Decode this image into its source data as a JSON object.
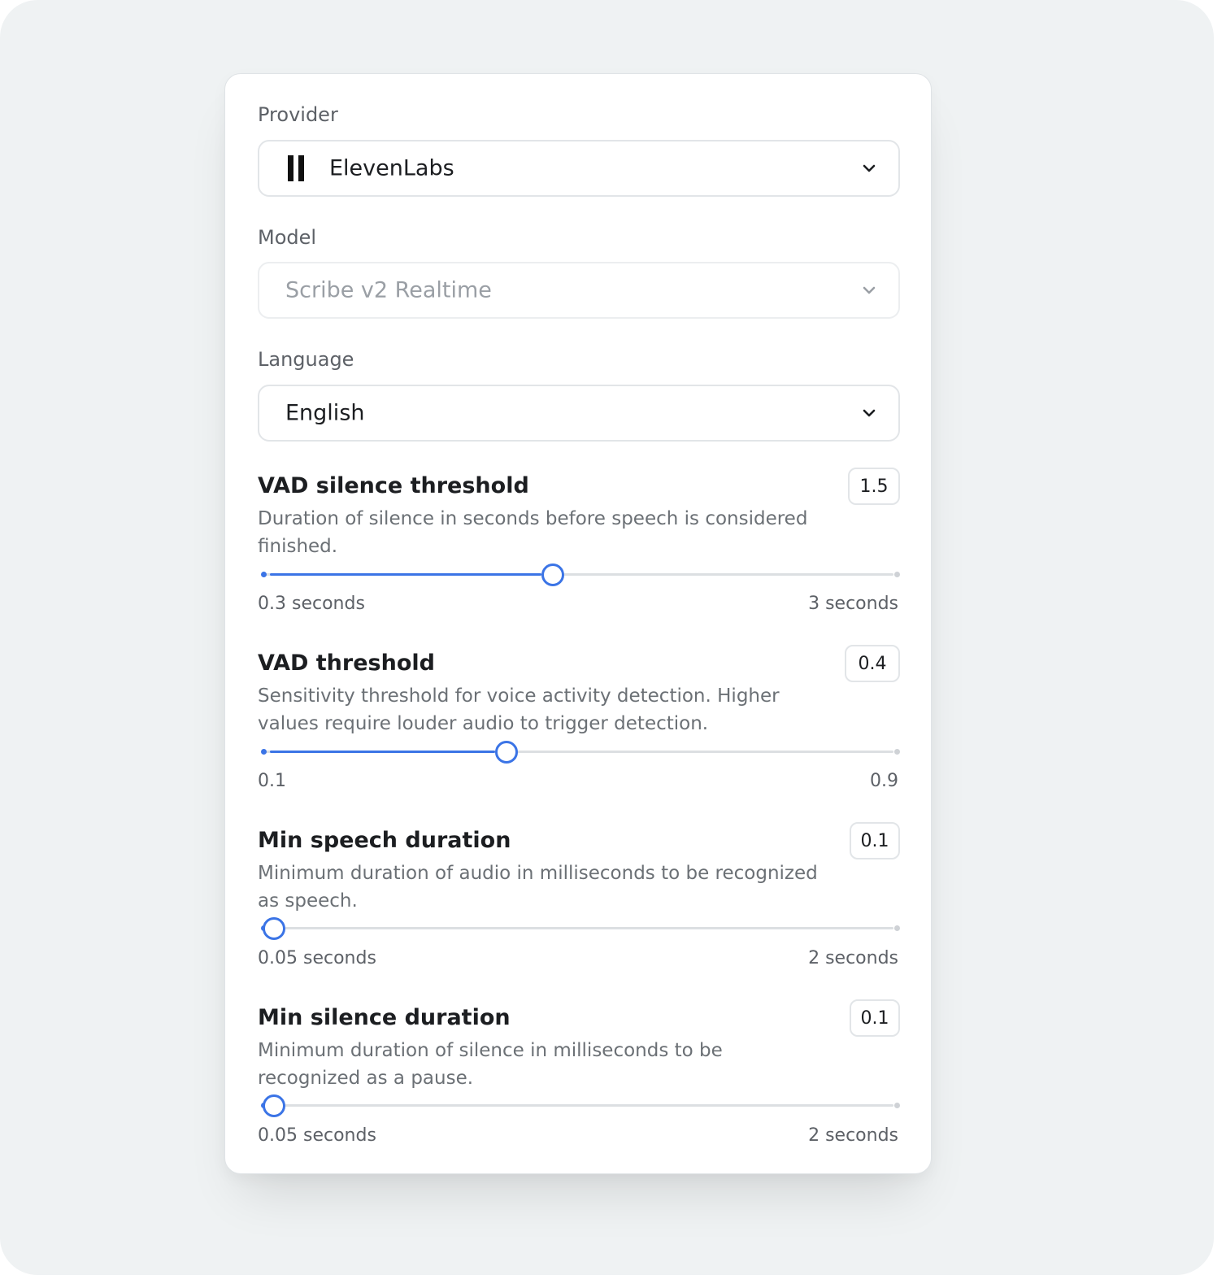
{
  "provider": {
    "label": "Provider",
    "value": "ElevenLabs",
    "icon": "elevenlabs-logo-icon"
  },
  "model": {
    "label": "Model",
    "value": "Scribe v2 Realtime",
    "disabled": true
  },
  "language": {
    "label": "Language",
    "value": "English"
  },
  "sliders": [
    {
      "title": "VAD silence threshold",
      "value": "1.5",
      "description": "Duration of silence in seconds before speech is considered finished.",
      "min_label": "0.3 seconds",
      "max_label": "3 seconds",
      "fraction": 0.45
    },
    {
      "title": "VAD threshold",
      "value": "0.4",
      "description": "Sensitivity threshold for voice activity detection. Higher values require louder audio to trigger detection.",
      "min_label": "0.1",
      "max_label": "0.9",
      "fraction": 0.375
    },
    {
      "title": "Min speech duration",
      "value": "0.1",
      "description": "Minimum duration of audio in milliseconds to be recognized as speech.",
      "min_label": "0.05 seconds",
      "max_label": "2 seconds",
      "fraction": 0.0
    },
    {
      "title": "Min silence duration",
      "value": "0.1",
      "description": "Minimum duration of silence in milliseconds to be recognized as a pause.",
      "min_label": "0.05 seconds",
      "max_label": "2 seconds",
      "fraction": 0.0
    }
  ],
  "colors": {
    "accent": "#3b74e6",
    "track": "#dcdfe2"
  }
}
